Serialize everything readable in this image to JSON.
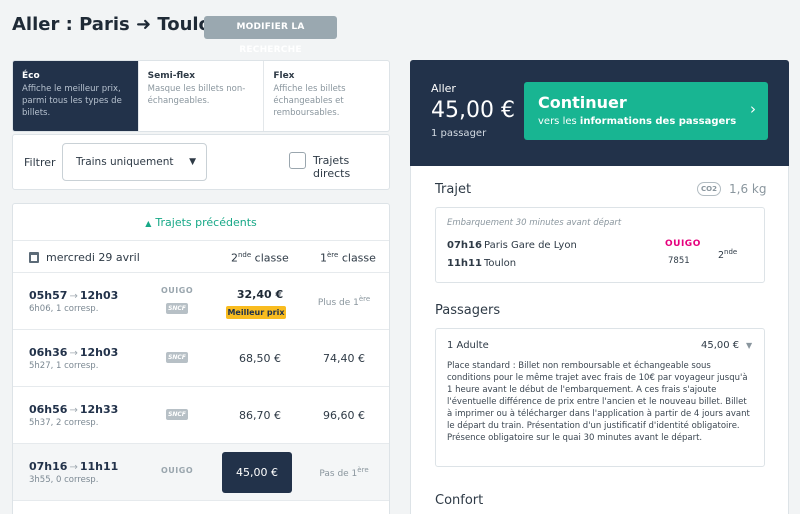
{
  "header": {
    "title": "Aller : Paris ➜ Toulon",
    "modify_label": "MODIFIER LA RECHERCHE"
  },
  "fare_tabs": [
    {
      "title": "Éco",
      "desc": "Affiche le meilleur prix, parmi tous les types de billets."
    },
    {
      "title": "Semi-flex",
      "desc": "Masque les billets non-échangeables."
    },
    {
      "title": "Flex",
      "desc": "Affiche les billets échangeables et remboursables."
    }
  ],
  "filter": {
    "label": "Filtrer",
    "select_value": "Trains uniquement",
    "direct_label": "Trajets directs"
  },
  "list": {
    "prev_label": "Trajets précédents",
    "date": "mercredi 29 avril",
    "class2_label": "2",
    "class2_sup": "nde",
    "class2_suffix": " classe",
    "class1_label": "1",
    "class1_sup": "ère",
    "class1_suffix": " classe",
    "rows": [
      {
        "dep": "05h57",
        "arr": "12h03",
        "dur": "6h06, 1 corresp.",
        "operator_ouigo": "OUIGO",
        "operator_sncf": "SNCF",
        "price2": "32,40 €",
        "badge": "Meilleur prix",
        "price1": "Plus de 1",
        "price1_sup": "ère"
      },
      {
        "dep": "06h36",
        "arr": "12h03",
        "dur": "5h27, 1 corresp.",
        "operator_sncf": "SNCF",
        "price2": "68,50 €",
        "price1": "74,40 €"
      },
      {
        "dep": "06h56",
        "arr": "12h33",
        "dur": "5h37, 2 corresp.",
        "operator_sncf": "SNCF",
        "price2": "86,70 €",
        "price1": "96,60 €"
      },
      {
        "dep": "07h16",
        "arr": "11h11",
        "dur": "3h55, 0 corresp.",
        "operator_ouigo": "OUIGO",
        "price2": "45,00 €",
        "price1": "Pas de 1",
        "price1_sup": "ère"
      }
    ]
  },
  "summary": {
    "direction": "Aller",
    "price": "45,00 €",
    "passengers": "1 passager",
    "continue_title": "Continuer",
    "continue_sub_prefix": "vers les ",
    "continue_sub_bold": "informations des passagers"
  },
  "trip": {
    "title": "Trajet",
    "co2_label": "CO2",
    "co2_value": "1,6 kg",
    "boarding": "Embarquement 30 minutes avant départ",
    "dep_time": "07h16",
    "dep_station": "Paris Gare de Lyon",
    "arr_time": "11h11",
    "arr_station": "Toulon",
    "operator": "OUIGO",
    "train_number": "7851",
    "class": "2",
    "class_sup": "nde"
  },
  "passengers": {
    "title": "Passagers",
    "name": "1 Adulte",
    "price": "45,00 €",
    "description": "Place standard : Billet non remboursable et échangeable sous conditions pour le même trajet avec frais de 10€ par voyageur jusqu'à 1 heure avant le début de l'embarquement. A ces frais s'ajoute l'éventuelle différence de prix entre l'ancien et le nouveau billet. Billet à imprimer ou à télécharger dans l'application à partir de 4 jours avant le départ du train. Présentation d'un justificatif d'identité obligatoire. Présence obligatoire sur le quai 30 minutes avant le départ."
  },
  "comfort": {
    "title": "Confort"
  }
}
